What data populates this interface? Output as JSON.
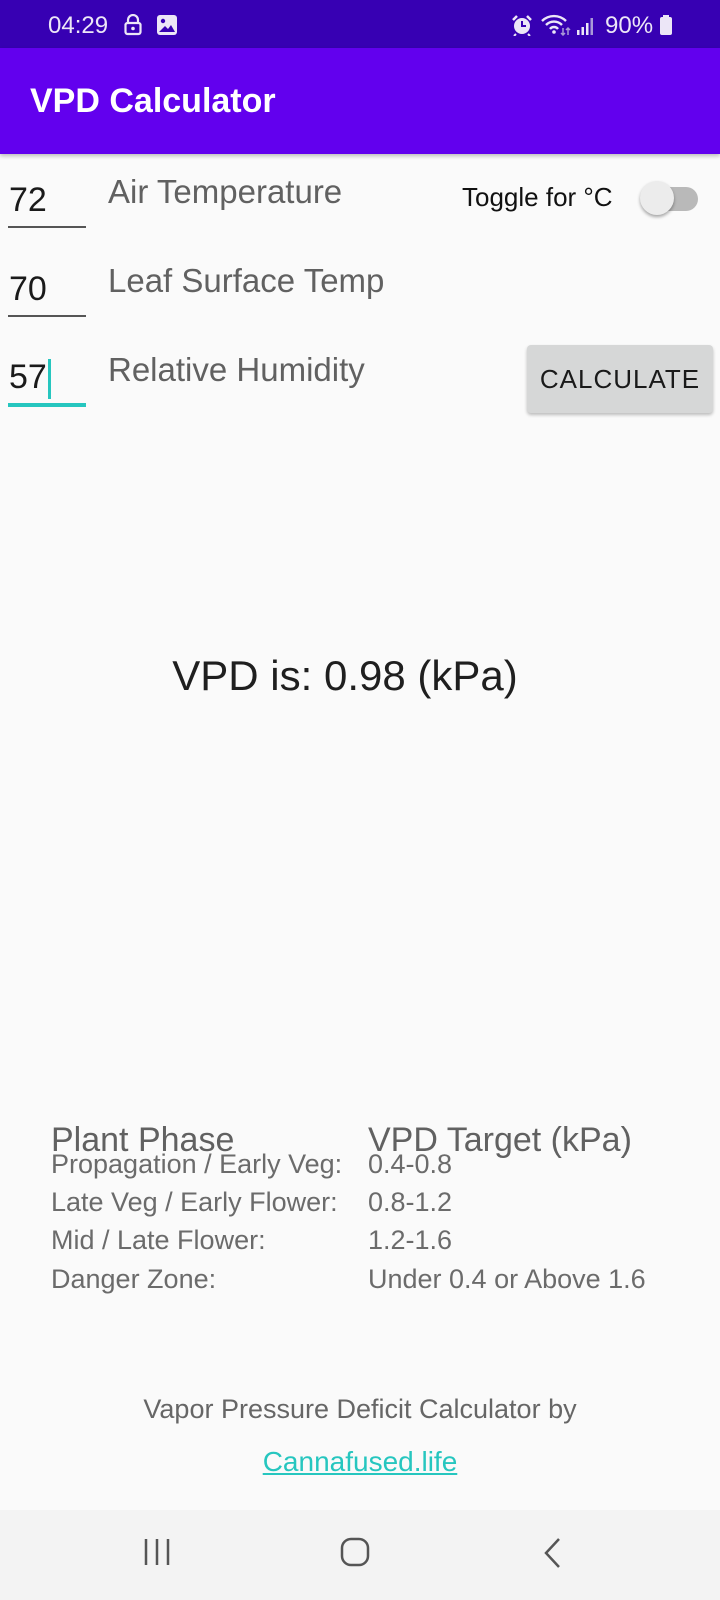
{
  "status_bar": {
    "time": "04:29",
    "left_icons": [
      "lock-icon",
      "image-icon"
    ],
    "right_icons": [
      "alarm-icon",
      "wifi-icon",
      "signal-icon",
      "battery-icon"
    ],
    "battery_percent": "90%"
  },
  "app_bar": {
    "title": "VPD Calculator"
  },
  "inputs": {
    "air_temperature": {
      "value": "72",
      "label": "Air Temperature"
    },
    "leaf_surface_temp": {
      "value": "70",
      "label": "Leaf Surface Temp"
    },
    "relative_humidity": {
      "value": "57",
      "label": "Relative Humidity",
      "focused": true
    }
  },
  "unit_toggle": {
    "label": "Toggle for °C",
    "checked": false
  },
  "calculate_button": {
    "label": "CALCULATE"
  },
  "result": {
    "text": "VPD is: 0.98 (kPa)"
  },
  "reference_table": {
    "headers": [
      "Plant Phase",
      "VPD Target (kPa)"
    ],
    "rows": [
      {
        "phase": "Propagation / Early Veg:",
        "target": "0.4-0.8"
      },
      {
        "phase": "Late Veg / Early Flower:",
        "target": "0.8-1.2"
      },
      {
        "phase": "Mid / Late Flower:",
        "target": "1.2-1.6"
      },
      {
        "phase": "Danger Zone:",
        "target": "Under 0.4 or Above 1.6"
      }
    ]
  },
  "footer": {
    "text": "Vapor Pressure Deficit Calculator by",
    "link_text": "Cannafused.life"
  },
  "nav_bar": {
    "buttons": [
      "recent-apps",
      "home",
      "back"
    ]
  },
  "colors": {
    "status_bar": "#3700b3",
    "app_bar": "#6200ee",
    "accent": "#26c6bf",
    "background": "#fafafa"
  }
}
